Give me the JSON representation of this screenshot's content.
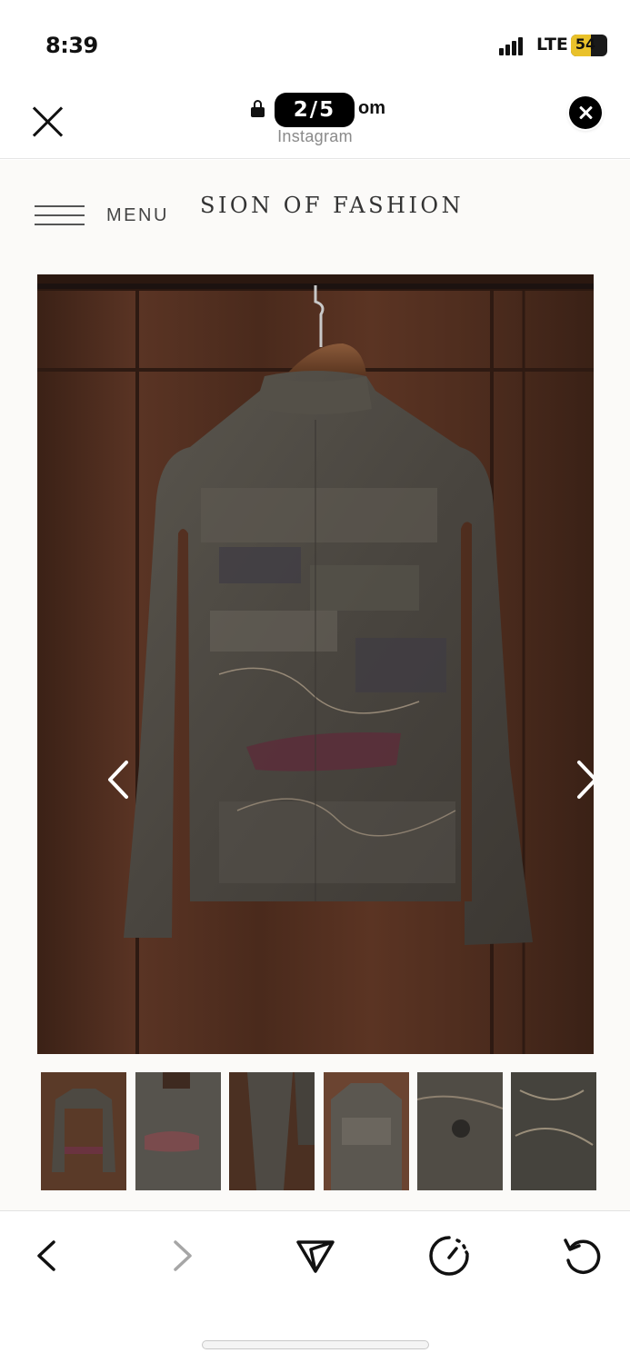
{
  "status_bar": {
    "time": "8:39",
    "network_label": "LTE",
    "battery_level": "54"
  },
  "browser": {
    "url_suffix": "om",
    "media_counter": "2/5",
    "source_label": "Instagram"
  },
  "site": {
    "menu_label": "MENU",
    "brand_text": "SION OF FASHION",
    "product_image_alt": "Shirt on hanger, back view",
    "thumbnail_count": 6
  },
  "toolbar": {
    "buttons": [
      "back-icon",
      "forward-icon",
      "share-icon",
      "timer-icon",
      "reload-icon"
    ]
  },
  "colors": {
    "background": "#ffffff",
    "site_background": "#fbfaf8",
    "wood_panel": "#4f2d1f",
    "shirt": "#4a4640",
    "pill": "#000000",
    "battery": "#e9c12a"
  }
}
